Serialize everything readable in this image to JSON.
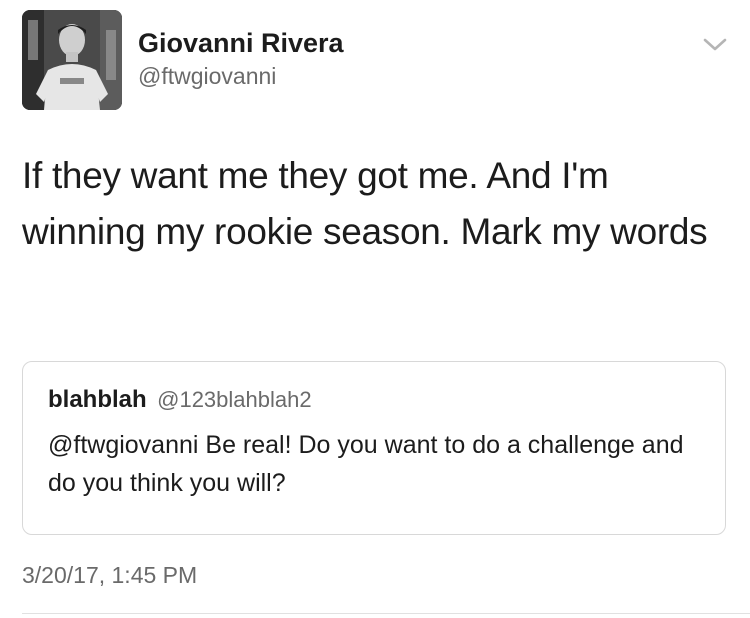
{
  "author": {
    "name": "Giovanni Rivera",
    "handle": "@ftwgiovanni",
    "avatar_icon": "profile-photo"
  },
  "tweet": {
    "text": "If they want me they got me. And I'm winning my rookie season. Mark my words",
    "timestamp": "3/20/17, 1:45 PM"
  },
  "quoted_tweet": {
    "name": "blahblah",
    "handle": "@123blahblah2",
    "text": "@ftwgiovanni Be real! Do you want to do a challenge and do you think you will?"
  },
  "icons": {
    "more": "chevron-down-icon"
  }
}
